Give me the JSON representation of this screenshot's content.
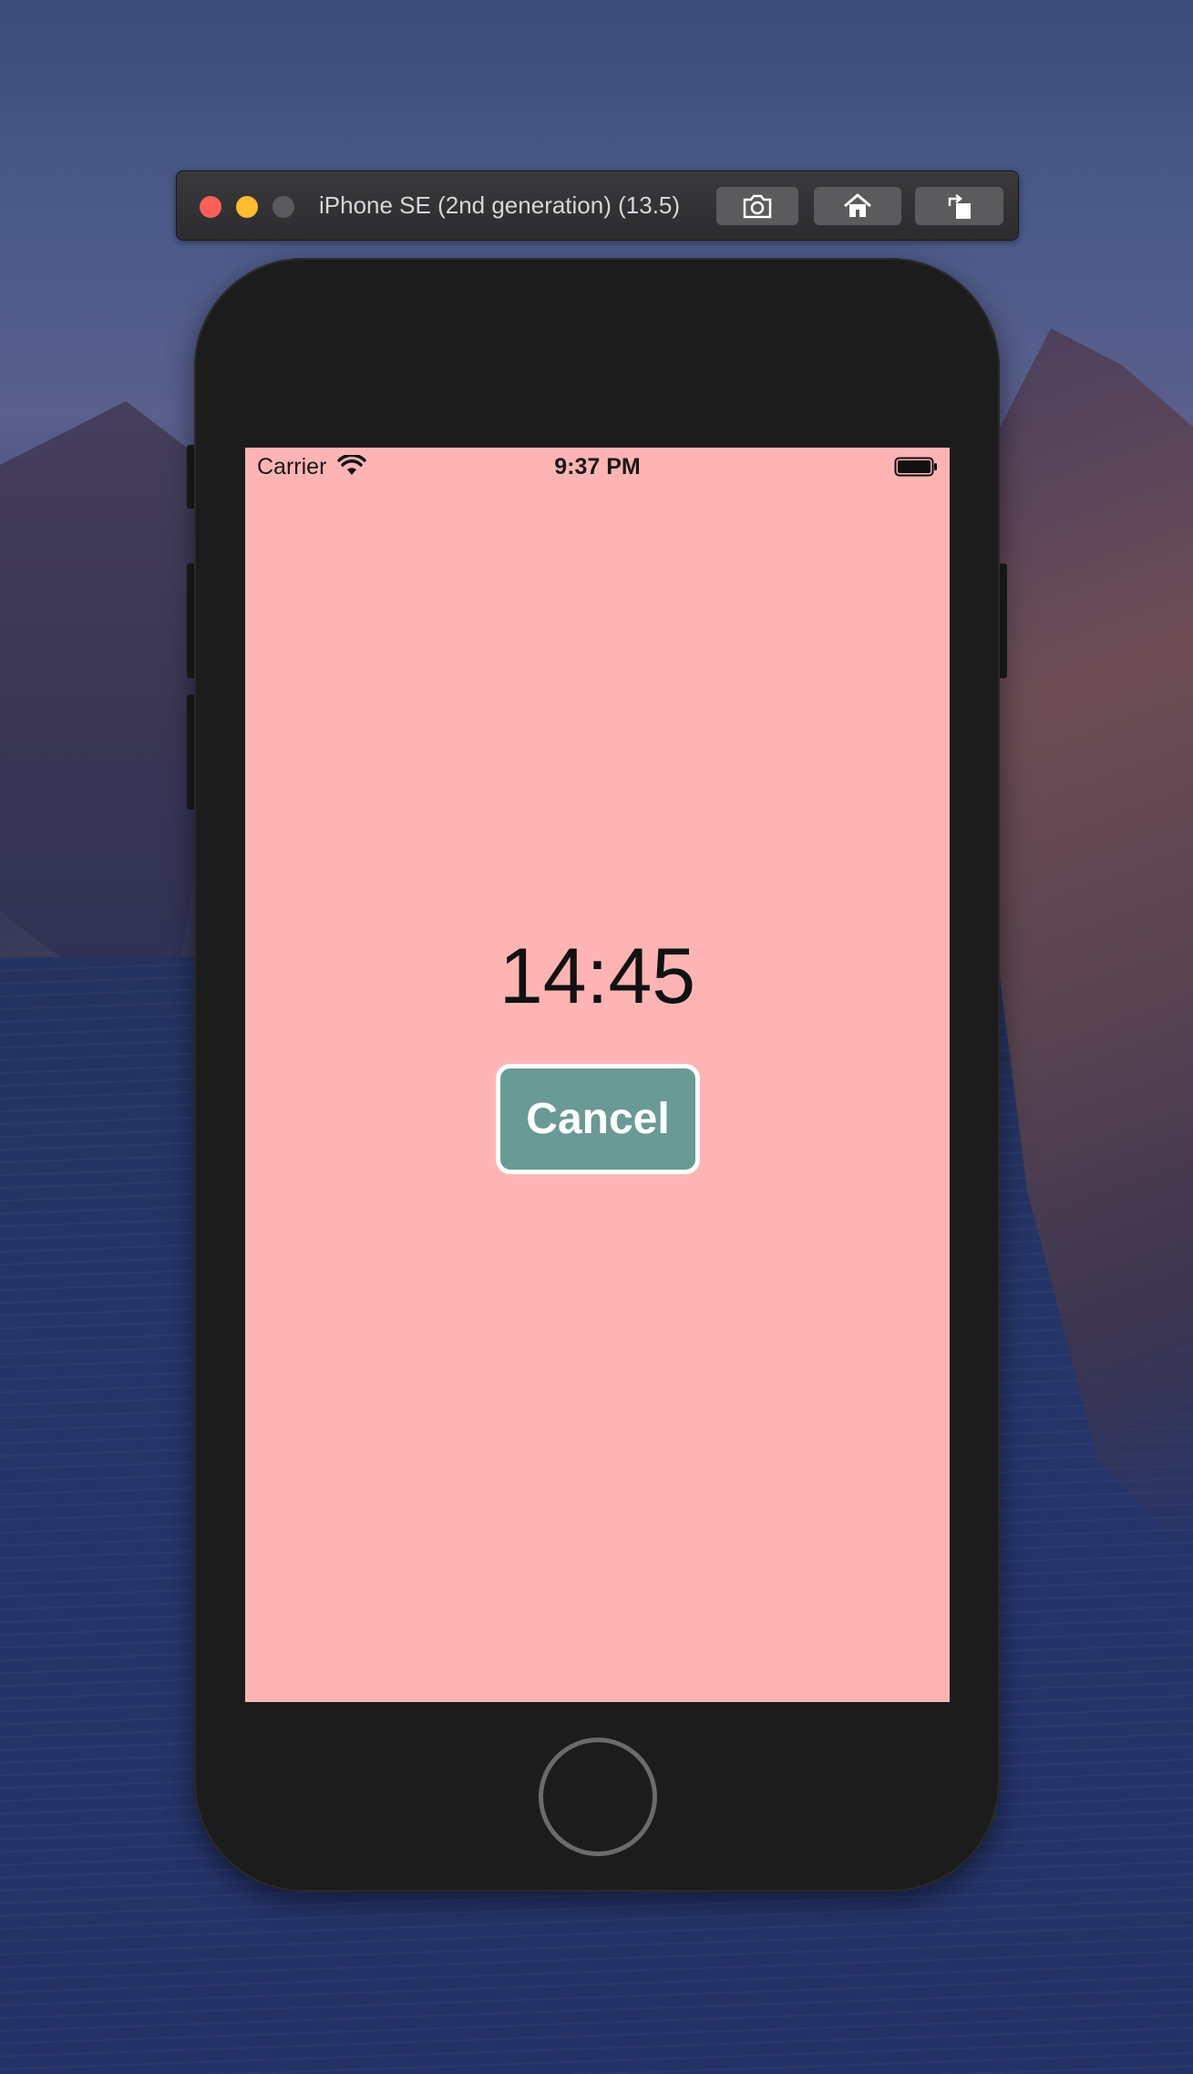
{
  "simulator": {
    "title": "iPhone SE (2nd generation) (13.5)",
    "toolbar": {
      "screenshot_icon": "camera-icon",
      "home_icon": "home-icon",
      "rotate_icon": "rotate-icon"
    }
  },
  "status_bar": {
    "carrier": "Carrier",
    "time": "9:37 PM",
    "wifi_icon": "wifi-icon",
    "battery_icon": "battery-icon"
  },
  "app": {
    "timer_text": "14:45",
    "cancel_label": "Cancel",
    "colors": {
      "background": "#ffb4b4",
      "button": "#6a9a96",
      "button_border": "#ffffff"
    }
  }
}
